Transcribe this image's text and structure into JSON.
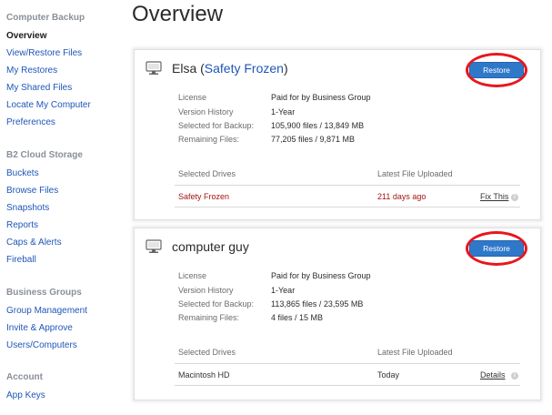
{
  "sidebar": {
    "sections": [
      {
        "heading": "Computer Backup",
        "items": [
          "Overview",
          "View/Restore Files",
          "My Restores",
          "My Shared Files",
          "Locate My Computer",
          "Preferences"
        ]
      },
      {
        "heading": "B2 Cloud Storage",
        "items": [
          "Buckets",
          "Browse Files",
          "Snapshots",
          "Reports",
          "Caps & Alerts",
          "Fireball"
        ]
      },
      {
        "heading": "Business Groups",
        "items": [
          "Group Management",
          "Invite & Approve",
          "Users/Computers"
        ]
      },
      {
        "heading": "Account",
        "items": [
          "App Keys"
        ]
      }
    ],
    "active_item": "Overview"
  },
  "page": {
    "title": "Overview"
  },
  "icons": {
    "computer": "monitor-icon",
    "info": "info-icon"
  },
  "colors": {
    "accent": "#2f78c9",
    "link": "#1f56b8",
    "alert": "#a31515",
    "annotation_ring": "#e8161c"
  },
  "cards": [
    {
      "name": "Elsa",
      "name_open": "(",
      "name_link": "Safety Frozen",
      "name_close": ")",
      "restore_label": "Restore",
      "info": [
        {
          "key": "License",
          "value": "Paid for by Business Group"
        },
        {
          "key": "Version History",
          "value": "1-Year"
        },
        {
          "key": "Selected for Backup:",
          "value": "105,900 files / 13,849 MB"
        },
        {
          "key": "Remaining Files:",
          "value": "77,205 files / 9,871 MB"
        }
      ],
      "table": {
        "col_drives": "Selected Drives",
        "col_latest": "Latest File Uploaded",
        "row": {
          "drive": "Safety Frozen",
          "latest": "211 days ago",
          "action": "Fix This"
        }
      }
    },
    {
      "name": "computer guy",
      "restore_label": "Restore",
      "info": [
        {
          "key": "License",
          "value": "Paid for by Business Group"
        },
        {
          "key": "Version History",
          "value": "1-Year"
        },
        {
          "key": "Selected for Backup:",
          "value": "113,865 files / 23,595 MB"
        },
        {
          "key": "Remaining Files:",
          "value": "4 files / 15 MB"
        }
      ],
      "table": {
        "col_drives": "Selected Drives",
        "col_latest": "Latest File Uploaded",
        "row": {
          "drive": "Macintosh HD",
          "latest": "Today",
          "action": "Details"
        }
      }
    }
  ]
}
